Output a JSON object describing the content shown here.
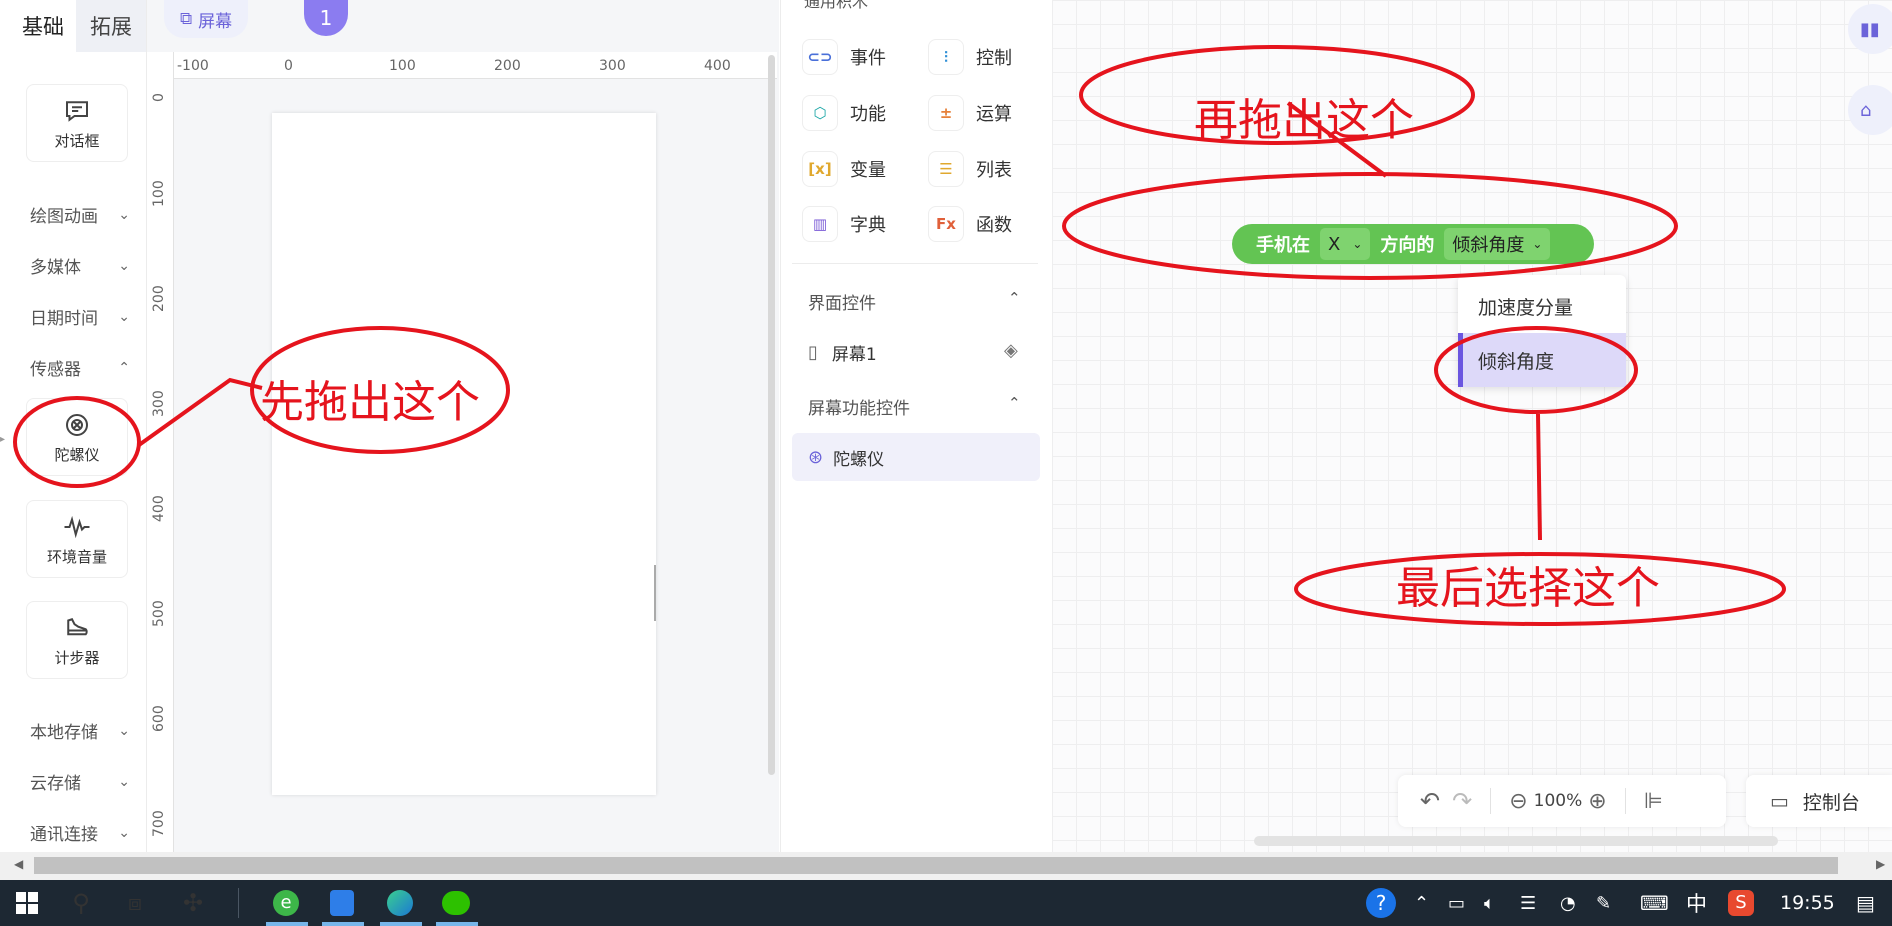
{
  "left_panel": {
    "tabs": [
      "基础",
      "拓展"
    ],
    "component_cards": {
      "dialog": "对话框",
      "gyroscope": "陀螺仪",
      "ambient_volume": "环境音量",
      "pedometer": "计步器"
    },
    "categories": {
      "drawing": "绘图动画",
      "multimedia": "多媒体",
      "datetime": "日期时间",
      "sensors": "传感器",
      "local_storage": "本地存储",
      "cloud_storage": "云存储",
      "communication": "通讯连接"
    }
  },
  "design_area": {
    "screen_pill": "屏幕",
    "page_number": "1",
    "ruler_h": [
      "-100",
      "0",
      "100",
      "200",
      "300",
      "400"
    ],
    "ruler_v": [
      "0",
      "100",
      "200",
      "300",
      "400",
      "500",
      "600",
      "700"
    ]
  },
  "blocks_panel": {
    "top_section_partial": "通用积木",
    "blocks": {
      "event": "事件",
      "control": "控制",
      "function": "功能",
      "operation": "运算",
      "variable": "变量",
      "list": "列表",
      "dictionary": "字典",
      "func": "函数"
    },
    "ui_controls_title": "界面控件",
    "screen_item": "屏幕1",
    "screen_func_title": "屏幕功能控件",
    "gyro_item": "陀螺仪"
  },
  "workspace": {
    "block": {
      "prefix": "手机在",
      "axis": "X",
      "middle": "方向的",
      "selected": "倾斜角度"
    },
    "dropdown_options": [
      "加速度分量",
      "倾斜角度"
    ],
    "zoom": "100%",
    "console": "控制台"
  },
  "annotations": {
    "drag_first": "先拖出这个",
    "drag_then": "再拖出这个",
    "select_last": "最后选择这个",
    "color": "#e5141d"
  },
  "taskbar": {
    "ime": "中",
    "time": "19:55"
  }
}
